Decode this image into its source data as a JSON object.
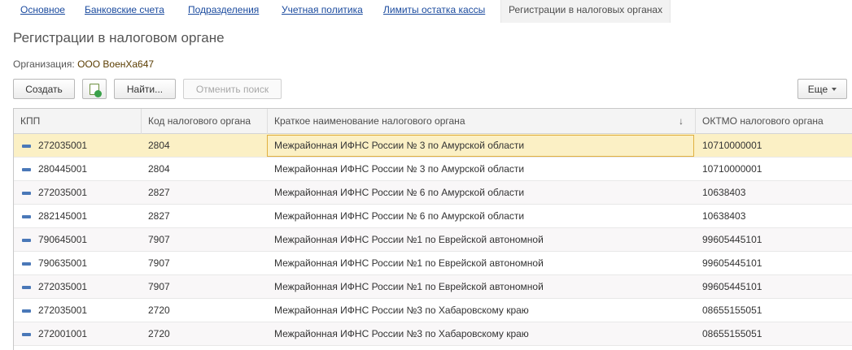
{
  "tabs": [
    {
      "label": "Основное"
    },
    {
      "label": "Банковские счета"
    },
    {
      "label": "Подразделения"
    },
    {
      "label": "Учетная политика"
    },
    {
      "label": "Лимиты остатка кассы"
    },
    {
      "label": "Регистрации в налоговых органах"
    }
  ],
  "active_tab": "Регистрации в налоговых органах",
  "page": {
    "title": "Регистрации в налоговом органе",
    "org_label": "Организация:",
    "org_value": "ООО ВоенХа647"
  },
  "toolbar": {
    "create_label": "Создать",
    "copy_icon": "add-document-icon",
    "find_label": "Найти...",
    "cancel_search_label": "Отменить поиск",
    "more_label": "Еще"
  },
  "table": {
    "columns": [
      {
        "label": "КПП"
      },
      {
        "label": "Код налогового органа"
      },
      {
        "label": "Краткое наименование налогового органа",
        "sorted": "desc"
      },
      {
        "label": "ОКТМО налогового органа"
      }
    ],
    "rows": [
      {
        "kpp": "272035001",
        "code": "2804",
        "name": "Межрайонная ИФНС России № 3 по Амурской области",
        "oktmo": "10710000001",
        "selected": true
      },
      {
        "kpp": "280445001",
        "code": "2804",
        "name": "Межрайонная ИФНС России № 3 по Амурской области",
        "oktmo": "10710000001"
      },
      {
        "kpp": "272035001",
        "code": "2827",
        "name": "Межрайонная ИФНС России № 6 по Амурской области",
        "oktmo": "10638403"
      },
      {
        "kpp": "282145001",
        "code": "2827",
        "name": "Межрайонная ИФНС России № 6 по Амурской области",
        "oktmo": "10638403"
      },
      {
        "kpp": "790645001",
        "code": "7907",
        "name": "Межрайонная ИФНС России №1 по Еврейской автономной",
        "oktmo": "99605445101"
      },
      {
        "kpp": "790635001",
        "code": "7907",
        "name": "Межрайонная ИФНС России №1 по Еврейской автономной",
        "oktmo": "99605445101"
      },
      {
        "kpp": "272035001",
        "code": "7907",
        "name": "Межрайонная ИФНС России №1 по Еврейской автономной",
        "oktmo": "99605445101"
      },
      {
        "kpp": "272035001",
        "code": "2720",
        "name": "Межрайонная ИФНС России №3 по Хабаровскому краю",
        "oktmo": "08655155051"
      },
      {
        "kpp": "272001001",
        "code": "2720",
        "name": "Межрайонная ИФНС России №3 по Хабаровскому краю",
        "oktmo": "08655155051"
      }
    ]
  },
  "colors": {
    "link": "#1a4a9e",
    "selected_row": "#fbf0c5",
    "focus_border": "#e0b040",
    "row_icon": "#4a78b8"
  }
}
